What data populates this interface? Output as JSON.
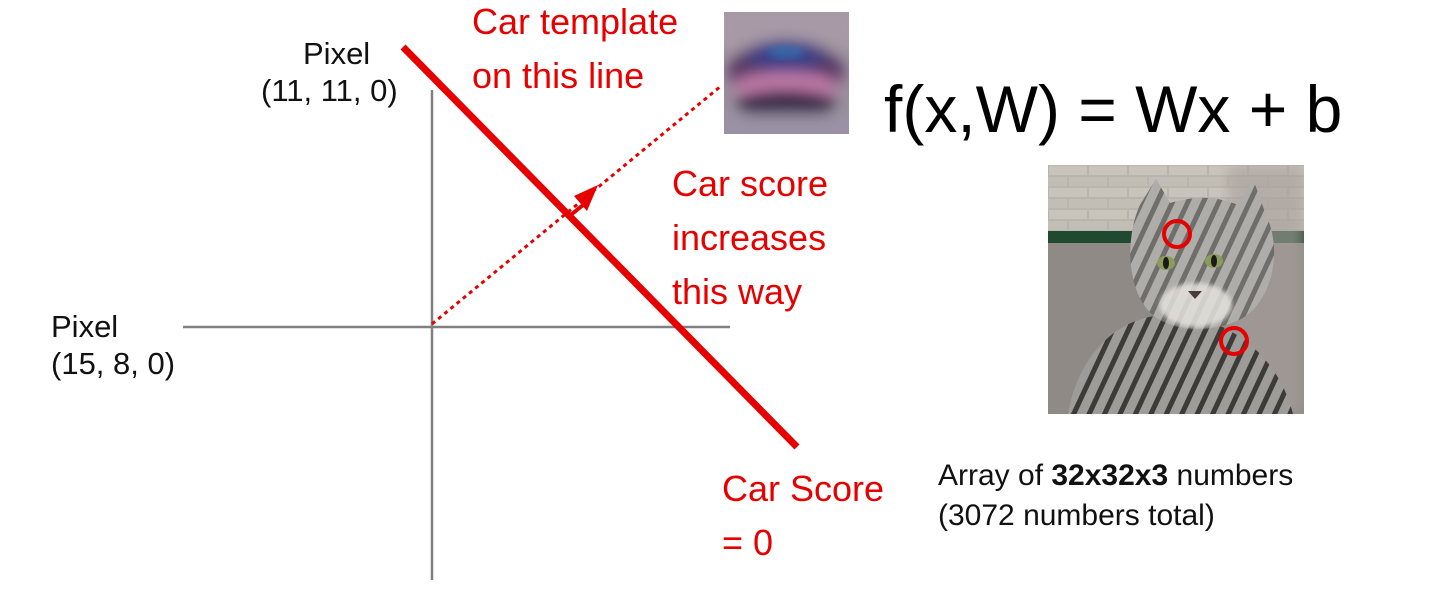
{
  "diagram": {
    "y_axis_label": [
      "Pixel",
      "(11, 11, 0)"
    ],
    "x_axis_label": [
      "Pixel",
      "(15, 8, 0)"
    ],
    "template_note": [
      "Car template",
      "on this line"
    ],
    "direction_note": [
      "Car score",
      "increases",
      "this way"
    ],
    "decision_line_label": [
      "Car Score",
      "= 0"
    ]
  },
  "equation": "f(x,W) = Wx + b",
  "caption": {
    "line1_prefix": "Array of ",
    "line1_bold": "32x32x3",
    "line1_suffix": " numbers",
    "line2": "(3072 numbers total)"
  },
  "colors": {
    "accent_red": "#e60000",
    "axis_gray": "#808080",
    "text": "#111111"
  },
  "images": {
    "car_template": "blurry-car-template-image",
    "cat": "tabby-cat-photo-with-two-highlighted-pixels"
  }
}
